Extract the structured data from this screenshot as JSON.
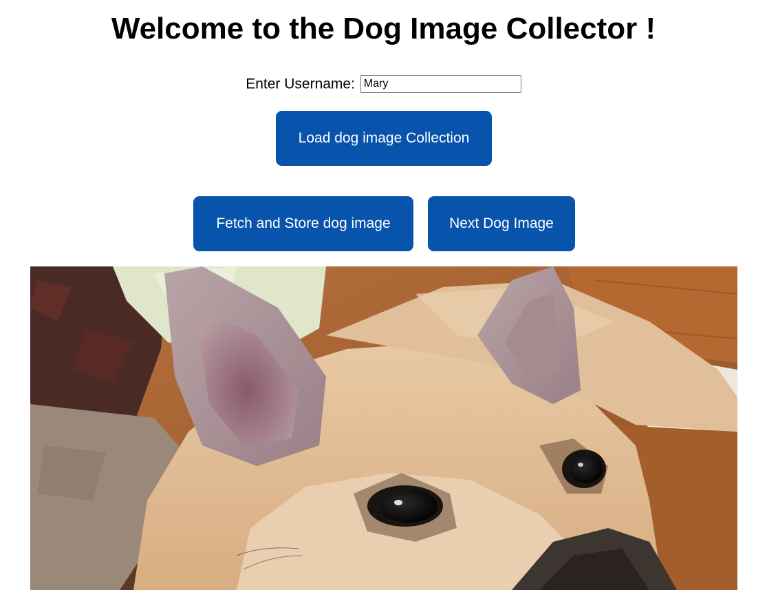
{
  "header": {
    "title": "Welcome to the Dog Image Collector !"
  },
  "username": {
    "label": "Enter Username:",
    "value": "Mary"
  },
  "buttons": {
    "load_collection": "Load dog image Collection",
    "fetch_store": "Fetch and Store dog image",
    "next_image": "Next Dog Image"
  },
  "colors": {
    "button_background": "#0853ac",
    "button_text": "#ffffff"
  }
}
